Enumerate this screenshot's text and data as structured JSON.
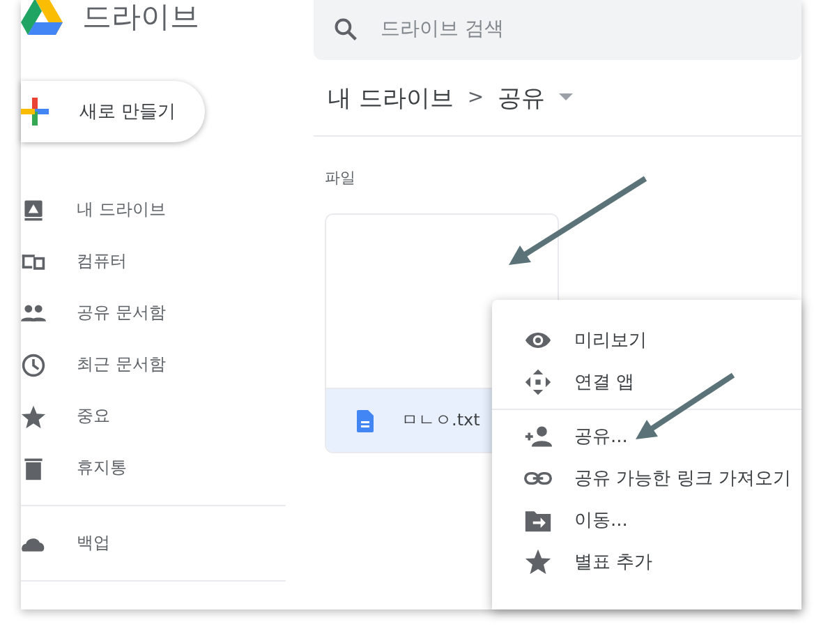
{
  "app": {
    "title": "드라이브"
  },
  "search": {
    "placeholder": "드라이브 검색"
  },
  "new_button": {
    "label": "새로 만들기"
  },
  "sidebar": {
    "items": [
      {
        "kind": "mydrive",
        "label": "내 드라이브"
      },
      {
        "kind": "computer",
        "label": "컴퓨터"
      },
      {
        "kind": "shared",
        "label": "공유 문서함"
      },
      {
        "kind": "recent",
        "label": "최근 문서함"
      },
      {
        "kind": "starred",
        "label": "중요"
      },
      {
        "kind": "trash",
        "label": "휴지통"
      },
      {
        "kind": "backup",
        "label": "백업",
        "divider_before": true
      }
    ]
  },
  "breadcrumb": {
    "root": "내 드라이브",
    "separator": ">",
    "current": "공유"
  },
  "section_title": "파일",
  "file": {
    "name": "ㅁㄴㅇ.txt",
    "selected": true
  },
  "context_menu": {
    "items": [
      {
        "kind": "preview",
        "label": "미리보기"
      },
      {
        "kind": "apps",
        "label": "연결 앱"
      },
      {
        "kind": "share",
        "label": "공유...",
        "divider_before": true
      },
      {
        "kind": "link",
        "label": "공유 가능한 링크 가져오기"
      },
      {
        "kind": "move",
        "label": "이동..."
      },
      {
        "kind": "star",
        "label": "별표 추가"
      }
    ]
  }
}
